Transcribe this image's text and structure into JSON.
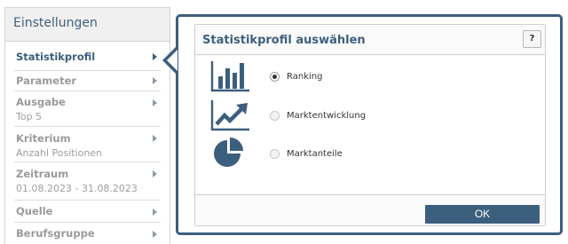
{
  "sidebar": {
    "title": "Einstellungen",
    "items": [
      {
        "label": "Statistikprofil",
        "value": ""
      },
      {
        "label": "Parameter",
        "value": ""
      },
      {
        "label": "Ausgabe",
        "value": "Top 5"
      },
      {
        "label": "Kriterium",
        "value": "Anzahl Positionen"
      },
      {
        "label": "Zeitraum",
        "value": "01.08.2023 - 31.08.2023"
      },
      {
        "label": "Quelle",
        "value": ""
      },
      {
        "label": "Berufsgruppe",
        "value": ""
      }
    ]
  },
  "dialog": {
    "title": "Statistikprofil auswählen",
    "help_label": "?",
    "options": [
      {
        "label": "Ranking",
        "icon": "bar-chart-icon",
        "selected": true
      },
      {
        "label": "Marktentwicklung",
        "icon": "trend-chart-icon",
        "selected": false
      },
      {
        "label": "Marktanteile",
        "icon": "pie-chart-icon",
        "selected": false
      }
    ],
    "ok_label": "OK"
  },
  "colors": {
    "accent": "#3d5f7e",
    "muted_text": "#9a9a9a",
    "border": "#d5d5d5"
  }
}
